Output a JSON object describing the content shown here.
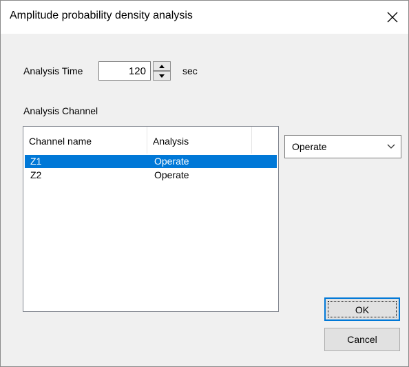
{
  "window": {
    "title": "Amplitude probability density analysis",
    "close_icon": "close-icon"
  },
  "analysis_time": {
    "label": "Analysis Time",
    "value": "120",
    "unit": "sec"
  },
  "analysis_channel": {
    "label": "Analysis Channel",
    "columns": [
      "Channel name",
      "Analysis"
    ],
    "rows": [
      {
        "channel": "Z1",
        "analysis": "Operate",
        "selected": true
      },
      {
        "channel": "Z2",
        "analysis": "Operate",
        "selected": false
      }
    ]
  },
  "analysis_mode": {
    "selected": "Operate"
  },
  "buttons": {
    "ok": "OK",
    "cancel": "Cancel"
  },
  "colors": {
    "selection": "#0078d7",
    "dialog_bg": "#f0f0f0",
    "titlebar_bg": "#ffffff"
  }
}
